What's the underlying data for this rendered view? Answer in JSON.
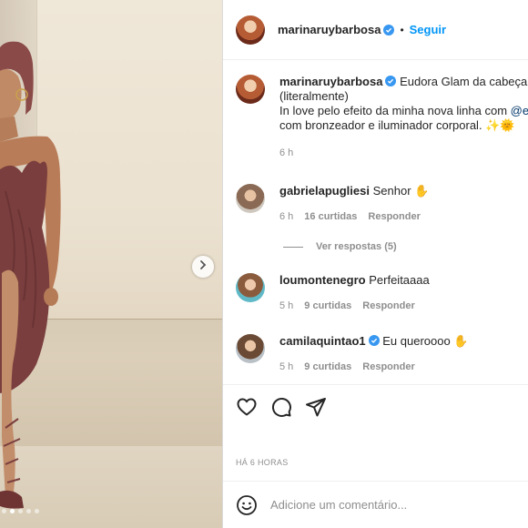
{
  "post": {
    "username": "marinaruybarbosa",
    "follow_label": "Seguir",
    "separator": "•"
  },
  "caption": {
    "username": "marinaruybarbosa",
    "line1": "Eudora Glam da cabeça ao",
    "line2": "(literalmente)",
    "line3_prefix": "In love pelo efeito da minha nova linha com ",
    "line3_mention": "@e",
    "line4": "com bronzeador e iluminador corporal. ✨🌞",
    "time": "6 h"
  },
  "comments": [
    {
      "username": "gabrielapugliesi",
      "text": "Senhor ✋",
      "time": "6 h",
      "likes": "16 curtidas",
      "reply": "Responder",
      "view_replies": "Ver respostas (5)"
    },
    {
      "username": "loumontenegro",
      "text": "Perfeitaaaa",
      "time": "5 h",
      "likes": "9 curtidas",
      "reply": "Responder"
    },
    {
      "username": "camilaquintao1",
      "text": "Eu queroooo ✋",
      "time": "5 h",
      "likes": "9 curtidas",
      "reply": "Responder"
    }
  ],
  "timestamp": "HÁ 6 HORAS",
  "add_comment": {
    "placeholder": "Adicione um comentário..."
  },
  "carousel": {
    "dots": 5,
    "active": 1
  },
  "colors": {
    "accent": "#0095f6",
    "verified": "#3897f0",
    "muted": "#8e8e8e",
    "dress": "#7a3e3e"
  }
}
